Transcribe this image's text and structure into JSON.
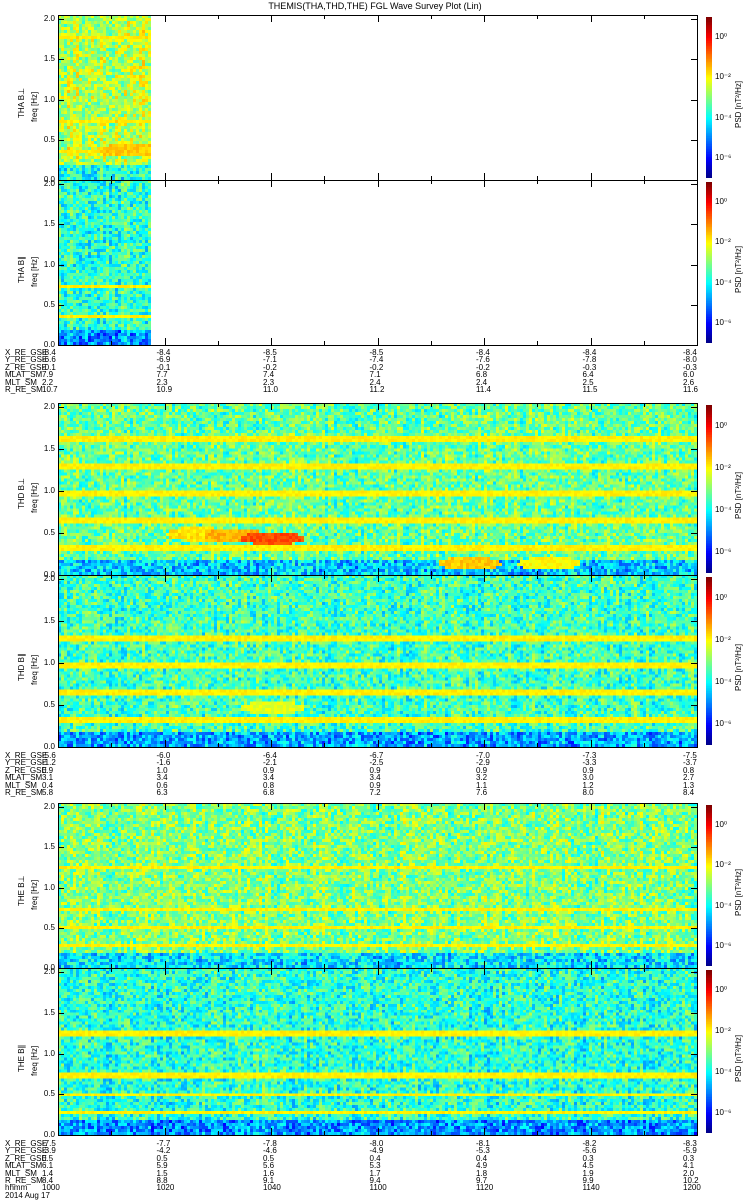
{
  "chart_data": {
    "type": "heatmap",
    "title": "THEMIS(THA,THD,THE) FGL Wave Survey Plot (Lin)",
    "x_axis": {
      "label": "hhmm",
      "range_min": [
        0,
        120
      ],
      "tick_labels": [
        "1000",
        "1020",
        "1040",
        "1100",
        "1120",
        "1140",
        "1200"
      ],
      "date": "2014 Aug 17"
    },
    "y_tick_labels": [
      "0.0",
      "0.5",
      "1.0",
      "1.5",
      "2.0"
    ],
    "ylim": [
      0,
      2.05
    ],
    "colorbar": {
      "label": "PSD [nT²/Hz]",
      "log_range": [
        -7,
        1
      ],
      "tick_labels": [
        "10⁰",
        "10⁻²",
        "10⁻⁴",
        "10⁻⁶"
      ],
      "tick_values": [
        0,
        -2,
        -4,
        -6
      ]
    },
    "panels": [
      {
        "probe": "THA",
        "ylabel": "THA B⊥",
        "sublabel": "freq [Hz]",
        "data_end_min": 17,
        "background_log": -2.6,
        "lines_hz": [
          0.33,
          0.7,
          1.75
        ],
        "blobs": [
          {
            "t": 13,
            "f": 0.35,
            "v": -1.6
          }
        ]
      },
      {
        "probe": "THA",
        "ylabel": "THA B∥",
        "sublabel": "freq [Hz]",
        "data_end_min": 17,
        "background_log": -3.6,
        "lines_hz": [
          0.33,
          0.7
        ],
        "blobs": []
      },
      {
        "probe": "THD",
        "ylabel": "THD B⊥",
        "sublabel": "freq [Hz]",
        "data_end_min": 120,
        "background_log": -3.2,
        "lines_hz": [
          0.3,
          0.63,
          0.95,
          1.27,
          1.6
        ],
        "blobs": [
          {
            "t": 40,
            "f": 0.42,
            "v": -0.6
          },
          {
            "t": 33,
            "f": 0.45,
            "v": -1.4
          },
          {
            "t": 26,
            "f": 0.47,
            "v": -1.8
          },
          {
            "t": 77,
            "f": 0.12,
            "v": -1.6
          },
          {
            "t": 92,
            "f": 0.12,
            "v": -2
          }
        ]
      },
      {
        "probe": "THD",
        "ylabel": "THD B∥",
        "sublabel": "freq [Hz]",
        "data_end_min": 120,
        "background_log": -3.5,
        "lines_hz": [
          0.3,
          0.63,
          0.95,
          1.27
        ],
        "blobs": [
          {
            "t": 40,
            "f": 0.45,
            "v": -2.2
          }
        ]
      },
      {
        "probe": "THE",
        "ylabel": "THE B⊥",
        "sublabel": "freq [Hz]",
        "data_end_min": 120,
        "background_log": -3.0,
        "lines_hz": [
          0.25,
          0.48,
          0.72,
          1.22
        ],
        "blobs": []
      },
      {
        "probe": "THE",
        "ylabel": "THE B∥",
        "sublabel": "freq [Hz]",
        "data_end_min": 120,
        "background_log": -3.7,
        "lines_hz": [
          0.25,
          0.48,
          0.72,
          1.22
        ],
        "blobs": []
      }
    ]
  },
  "ephemeris": [
    {
      "rows": [
        {
          "label": "X_RE_GSE",
          "values": [
            "-8.4",
            "-8.4",
            "-8.5",
            "-8.5",
            "-8.4",
            "-8.4",
            "-8.4"
          ]
        },
        {
          "label": "Y_RE_GSE",
          "values": [
            "-6.6",
            "-6.9",
            "-7.1",
            "-7.4",
            "-7.6",
            "-7.8",
            "-8.0"
          ]
        },
        {
          "label": "Z_RE_GSE",
          "values": [
            "-0.1",
            "-0.1",
            "-0.2",
            "-0.2",
            "-0.2",
            "-0.3",
            "-0.3"
          ]
        },
        {
          "label": "MLAT_SM",
          "values": [
            "7.9",
            "7.7",
            "7.4",
            "7.1",
            "6.8",
            "6.4",
            "6.0"
          ]
        },
        {
          "label": "MLT_SM",
          "values": [
            "2.2",
            "2.3",
            "2.3",
            "2.4",
            "2.4",
            "2.5",
            "2.6"
          ]
        },
        {
          "label": "R_RE_SM",
          "values": [
            "10.7",
            "10.9",
            "11.0",
            "11.2",
            "11.4",
            "11.5",
            "11.6"
          ]
        }
      ]
    },
    {
      "rows": [
        {
          "label": "X_RE_GSE",
          "values": [
            "-5.6",
            "-6.0",
            "-6.4",
            "-6.7",
            "-7.0",
            "-7.3",
            "-7.5"
          ]
        },
        {
          "label": "Y_RE_GSE",
          "values": [
            "-1.2",
            "-1.6",
            "-2.1",
            "-2.5",
            "-2.9",
            "-3.3",
            "-3.7"
          ]
        },
        {
          "label": "Z_RE_GSE",
          "values": [
            "0.9",
            "1.0",
            "0.9",
            "0.9",
            "0.9",
            "0.9",
            "0.8"
          ]
        },
        {
          "label": "MLAT_SM",
          "values": [
            "3.1",
            "3.4",
            "3.4",
            "3.4",
            "3.2",
            "3.0",
            "2.7"
          ]
        },
        {
          "label": "MLT_SM",
          "values": [
            "0.4",
            "0.6",
            "0.8",
            "0.9",
            "1.1",
            "1.2",
            "1.3"
          ]
        },
        {
          "label": "R_RE_SM",
          "values": [
            "5.8",
            "6.3",
            "6.8",
            "7.2",
            "7.6",
            "8.0",
            "8.4"
          ]
        }
      ]
    },
    {
      "rows": [
        {
          "label": "X_RE_GSE",
          "values": [
            "-7.5",
            "-7.7",
            "-7.8",
            "-8.0",
            "-8.1",
            "-8.2",
            "-8.3"
          ]
        },
        {
          "label": "Y_RE_GSE",
          "values": [
            "-3.9",
            "-4.2",
            "-4.6",
            "-4.9",
            "-5.3",
            "-5.6",
            "-5.9"
          ]
        },
        {
          "label": "Z_RE_GSE",
          "values": [
            "0.5",
            "0.5",
            "0.5",
            "0.4",
            "0.4",
            "0.3",
            "0.3"
          ]
        },
        {
          "label": "MLAT_SM",
          "values": [
            "6.1",
            "5.9",
            "5.6",
            "5.3",
            "4.9",
            "4.5",
            "4.1"
          ]
        },
        {
          "label": "MLT_SM",
          "values": [
            "1.4",
            "1.5",
            "1.6",
            "1.7",
            "1.8",
            "1.9",
            "2.0"
          ]
        },
        {
          "label": "R_RE_SM",
          "values": [
            "8.4",
            "8.8",
            "9.1",
            "9.4",
            "9.7",
            "9.9",
            "10.2"
          ]
        },
        {
          "label": "hhmm",
          "values": [
            "1000",
            "1020",
            "1040",
            "1100",
            "1120",
            "1140",
            "1200"
          ]
        }
      ],
      "date": "2014 Aug 17"
    }
  ]
}
